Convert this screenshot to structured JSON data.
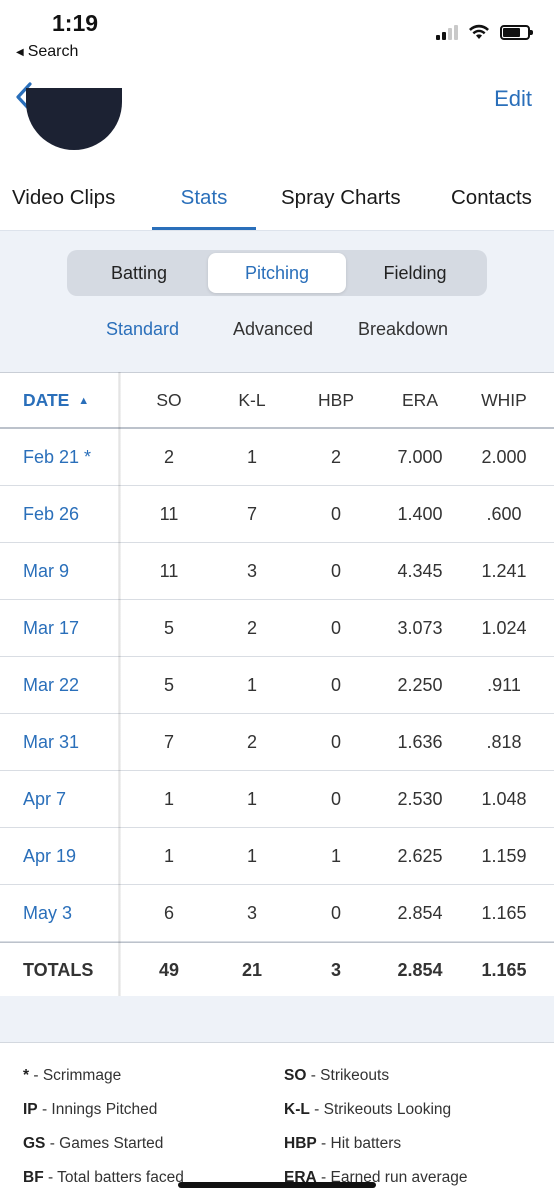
{
  "status_bar": {
    "time": "1:19",
    "back_label": "Search"
  },
  "nav": {
    "edit_label": "Edit"
  },
  "top_tabs": [
    {
      "label": "Video Clips",
      "active": false
    },
    {
      "label": "Stats",
      "active": true
    },
    {
      "label": "Spray Charts",
      "active": false
    },
    {
      "label": "Contacts",
      "active": false
    }
  ],
  "segmented": [
    {
      "label": "Batting",
      "active": false
    },
    {
      "label": "Pitching",
      "active": true
    },
    {
      "label": "Fielding",
      "active": false
    }
  ],
  "subtabs": [
    {
      "label": "Standard",
      "active": true
    },
    {
      "label": "Advanced",
      "active": false
    },
    {
      "label": "Breakdown",
      "active": false
    }
  ],
  "table": {
    "headers": {
      "date": "DATE",
      "sort_icon": "▲",
      "so": "SO",
      "kl": "K-L",
      "hbp": "HBP",
      "era": "ERA",
      "whip": "WHIP"
    },
    "rows": [
      {
        "date": "Feb 21 *",
        "so": "2",
        "kl": "1",
        "hbp": "2",
        "era": "7.000",
        "whip": "2.000"
      },
      {
        "date": "Feb 26",
        "so": "11",
        "kl": "7",
        "hbp": "0",
        "era": "1.400",
        "whip": ".600"
      },
      {
        "date": "Mar 9",
        "so": "11",
        "kl": "3",
        "hbp": "0",
        "era": "4.345",
        "whip": "1.241"
      },
      {
        "date": "Mar 17",
        "so": "5",
        "kl": "2",
        "hbp": "0",
        "era": "3.073",
        "whip": "1.024"
      },
      {
        "date": "Mar 22",
        "so": "5",
        "kl": "1",
        "hbp": "0",
        "era": "2.250",
        "whip": ".911"
      },
      {
        "date": "Mar 31",
        "so": "7",
        "kl": "2",
        "hbp": "0",
        "era": "1.636",
        "whip": ".818"
      },
      {
        "date": "Apr 7",
        "so": "1",
        "kl": "1",
        "hbp": "0",
        "era": "2.530",
        "whip": "1.048"
      },
      {
        "date": "Apr 19",
        "so": "1",
        "kl": "1",
        "hbp": "1",
        "era": "2.625",
        "whip": "1.159"
      },
      {
        "date": "May 3",
        "so": "6",
        "kl": "3",
        "hbp": "0",
        "era": "2.854",
        "whip": "1.165"
      }
    ],
    "totals": {
      "date": "TOTALS",
      "so": "49",
      "kl": "21",
      "hbp": "3",
      "era": "2.854",
      "whip": "1.165"
    }
  },
  "legend": [
    {
      "key": "*",
      "desc": " - Scrimmage"
    },
    {
      "key": "SO",
      "desc": " - Strikeouts"
    },
    {
      "key": "IP",
      "desc": " - Innings Pitched"
    },
    {
      "key": "K-L",
      "desc": " - Strikeouts Looking"
    },
    {
      "key": "GS",
      "desc": " - Games Started"
    },
    {
      "key": "HBP",
      "desc": " - Hit batters"
    },
    {
      "key": "BF",
      "desc": " - Total batters faced"
    },
    {
      "key": "ERA",
      "desc": " - Earned run average"
    }
  ],
  "colors": {
    "accent": "#2a6fba",
    "panel_bg": "#eef2f8",
    "segment_bg": "#d5dae2"
  }
}
